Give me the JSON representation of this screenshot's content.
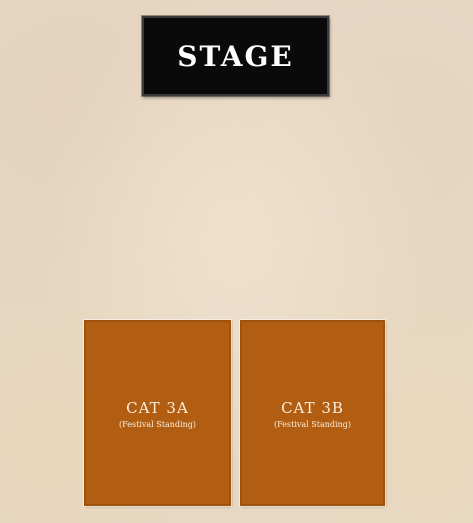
{
  "stage": {
    "label": "STAGE"
  },
  "sections": [
    {
      "name": "CAT 3A",
      "type": "(Festival Standing)",
      "color": "#b25e12"
    },
    {
      "name": "CAT 3B",
      "type": "(Festival Standing)",
      "color": "#b25e12"
    }
  ],
  "colors": {
    "background": "#e6d8c6",
    "stage": "#0a0a0a",
    "section": "#b25e12"
  }
}
